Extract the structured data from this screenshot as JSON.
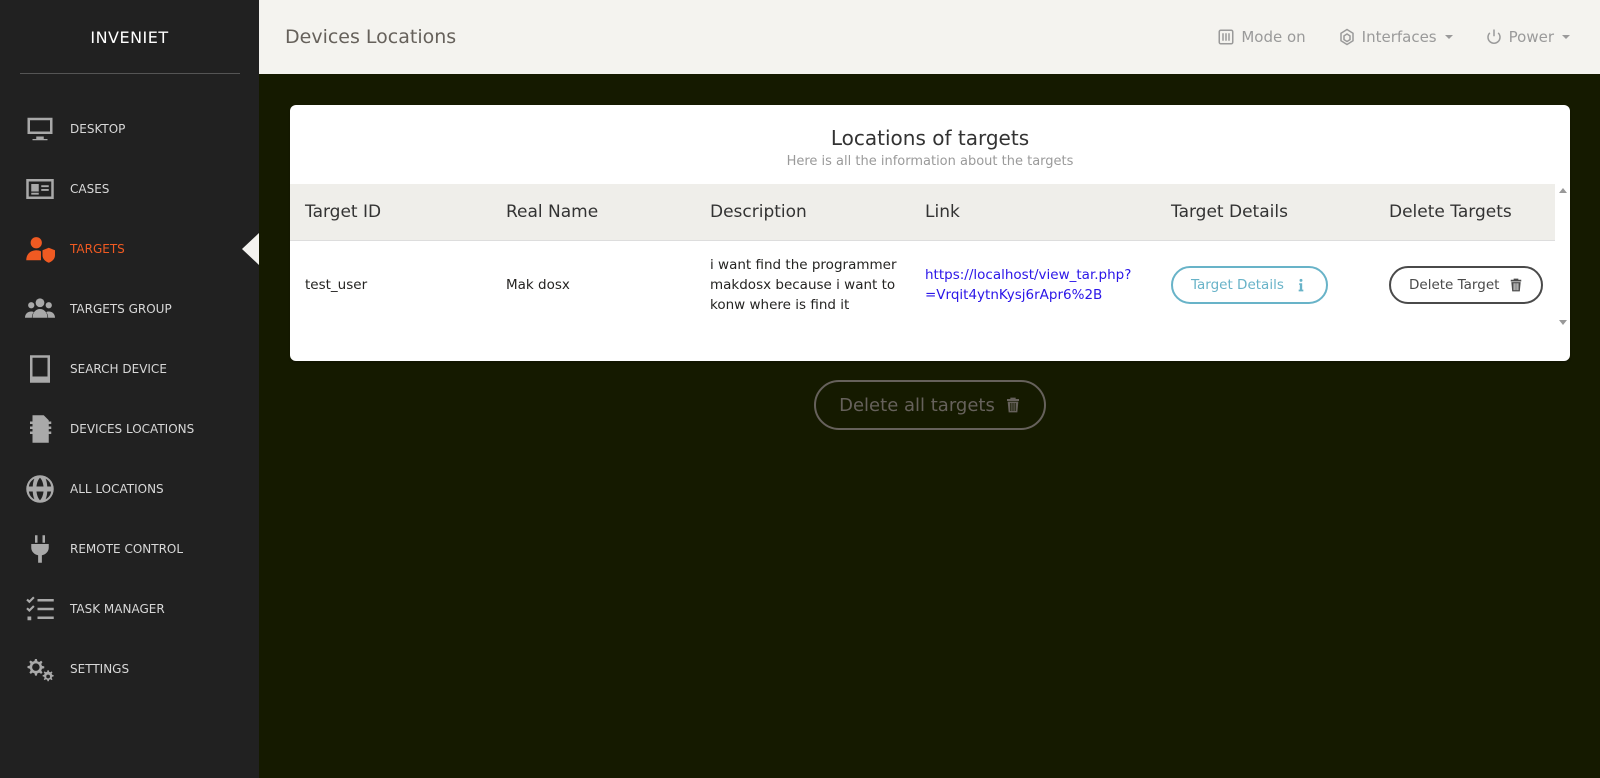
{
  "app": {
    "brand": "INVENIET"
  },
  "sidebar": {
    "items": [
      {
        "label": "DESKTOP",
        "icon": "monitor-icon"
      },
      {
        "label": "CASES",
        "icon": "id-card-icon"
      },
      {
        "label": "TARGETS",
        "icon": "user-shield-icon",
        "active": true
      },
      {
        "label": "TARGETS GROUP",
        "icon": "users-icon"
      },
      {
        "label": "SEARCH DEVICE",
        "icon": "tablet-icon"
      },
      {
        "label": "DEVICES LOCATIONS",
        "icon": "sim-card-icon"
      },
      {
        "label": "ALL LOCATIONS",
        "icon": "globe-icon"
      },
      {
        "label": "REMOTE CONTROL",
        "icon": "plug-icon"
      },
      {
        "label": "TASK MANAGER",
        "icon": "task-list-icon"
      },
      {
        "label": "SETTINGS",
        "icon": "gears-icon"
      }
    ]
  },
  "header": {
    "title": "Devices Locations",
    "actions": {
      "mode": "Mode on",
      "interfaces": "Interfaces",
      "power": "Power"
    }
  },
  "card": {
    "title": "Locations of targets",
    "subtitle": "Here is all the information about the targets",
    "columns": [
      "Target ID",
      "Real Name",
      "Description",
      "Link",
      "Target Details",
      "Delete Targets"
    ],
    "rows": [
      {
        "target_id": "test_user",
        "real_name": "Mak dosx",
        "description": "i want find the programmer makdosx because i want to konw where is find it",
        "link": "https://localhost/view_tar.php?=Vrqit4ytnKysj6rApr6%2B",
        "details_label": "Target Details",
        "delete_label": "Delete Target"
      }
    ]
  },
  "delete_all_label": "Delete all targets",
  "colors": {
    "accent": "#f05a22",
    "info": "#68b3c8",
    "link": "#2a15e8",
    "background": "#151a00",
    "sidebar": "#212121"
  }
}
